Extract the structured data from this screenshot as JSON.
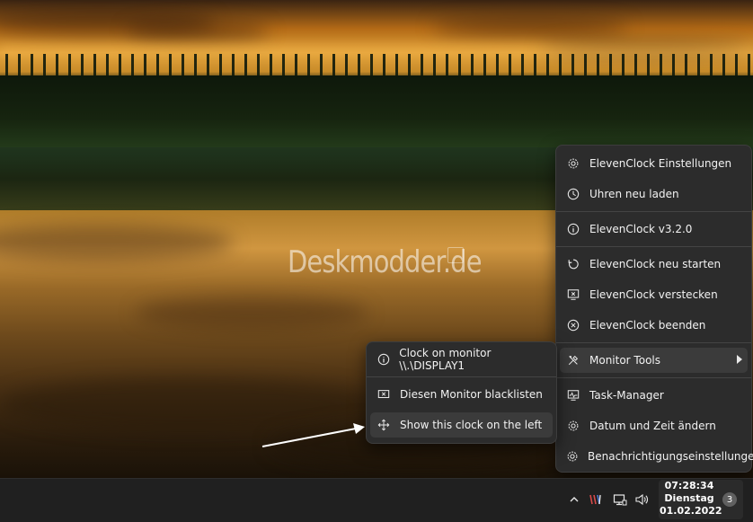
{
  "watermark": "Deskmodder.de",
  "main_menu": {
    "items": [
      {
        "label": "ElevenClock Einstellungen",
        "icon": "gear-icon"
      },
      {
        "label": "Uhren neu laden",
        "icon": "clock-icon"
      },
      {
        "label": "ElevenClock v3.2.0",
        "icon": "info-icon"
      },
      {
        "label": "ElevenClock neu starten",
        "icon": "restart-icon"
      },
      {
        "label": "ElevenClock verstecken",
        "icon": "hide-monitor-icon"
      },
      {
        "label": "ElevenClock beenden",
        "icon": "close-circle-icon"
      },
      {
        "label": "Monitor Tools",
        "icon": "tools-icon"
      },
      {
        "label": "Task-Manager",
        "icon": "task-manager-icon"
      },
      {
        "label": "Datum und Zeit ändern",
        "icon": "gear-icon"
      },
      {
        "label": "Benachrichtigungseinstellungen",
        "icon": "gear-icon"
      }
    ]
  },
  "sub_menu": {
    "items": [
      {
        "label": "Clock on monitor \\\\.\\DISPLAY1",
        "icon": "info-icon"
      },
      {
        "label": "Diesen Monitor blacklisten",
        "icon": "blacklist-monitor-icon"
      },
      {
        "label": "Show this clock on the left",
        "icon": "move-icon"
      }
    ]
  },
  "taskbar": {
    "time": "07:28:34",
    "day": "Dienstag",
    "date": "01.02.2022",
    "notification_count": "3"
  }
}
